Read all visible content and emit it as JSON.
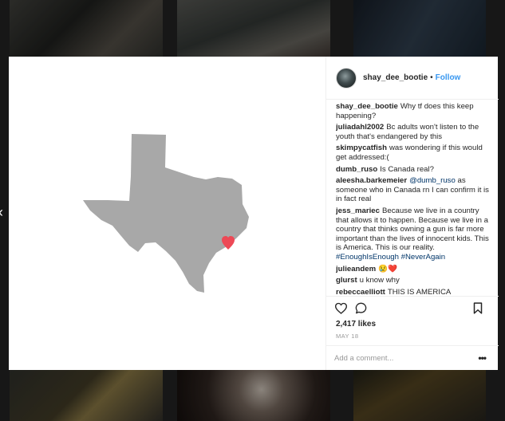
{
  "post": {
    "username": "shay_dee_bootie",
    "dot": "•",
    "follow_label": "Follow",
    "likes": "2,417 likes",
    "date": "MAY 18",
    "comment_placeholder": "Add a comment...",
    "more_label": "•••",
    "heart_color": "#ed4956",
    "map_color": "#a8a8a8"
  },
  "comments": [
    {
      "user": "shay_dee_bootie",
      "text": "Why tf does this keep happening?"
    },
    {
      "user": "juliadahl2002",
      "text": "Bc adults won't listen to the youth that's endangered by this"
    },
    {
      "user": "skimpycatfish",
      "text": "was wondering if this would get addressed:("
    },
    {
      "user": "dumb_ruso",
      "text": "Is Canada real?"
    },
    {
      "user": "aleesha.barkemeier",
      "mention": "@dumb_ruso",
      "text": "as someone who in Canada rn I can confirm it is in fact real"
    },
    {
      "user": "jess_mariec",
      "text": "Because we live in a country that allows it to happen. Because we live in a country that thinks owning a gun is far more important than the lives of innocent kids. This is America. This is our reality.",
      "hashtags": "#EnoughIsEnough #NeverAgain"
    },
    {
      "user": "julieandem",
      "text": "😢❤️"
    },
    {
      "user": "glurst",
      "text": "u know why"
    },
    {
      "user": "rebeccaelliott",
      "text": "THIS IS AMERICA"
    }
  ],
  "nav": {
    "prev_arrow": "‹"
  }
}
